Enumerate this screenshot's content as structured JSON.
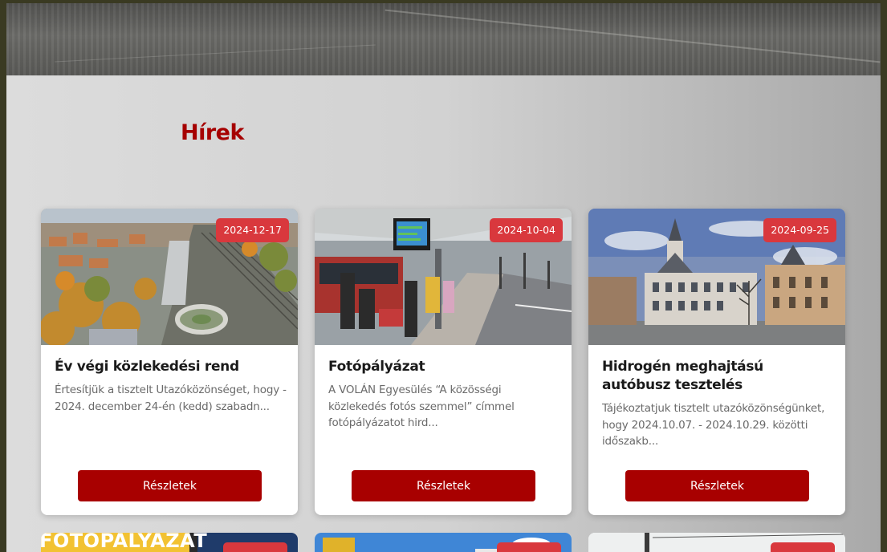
{
  "section": {
    "title": "Hírek"
  },
  "cards": [
    {
      "date": "2024-12-17",
      "title": "Év végi közlekedési rend",
      "excerpt": "Értesítjük a tisztelt Utazóközönséget, hogy - 2024. december 24-én (kedd) szabadn...",
      "button": "Részletek",
      "image": "aerial-city-roundabout-railway"
    },
    {
      "date": "2024-10-04",
      "title": "Fotópályázat",
      "excerpt": "A VOLÁN Egyesülés “A közösségi közlekedés fotós szemmel” címmel fotópályázatot hird...",
      "button": "Részletek",
      "image": "bus-station-platform"
    },
    {
      "date": "2024-09-25",
      "title": "Hidrogén meghajtású autóbusz tesztelés",
      "excerpt": "Tájékoztatjuk tisztelt utazóközönségünket, hogy 2024.10.07. - 2024.10.29. közötti időszakb...",
      "button": "Részletek",
      "image": "city-hall-square"
    }
  ],
  "peek_cards": [
    {
      "image": "fotopalyazat-poster",
      "poster_text": "FOTÓPÁLYÁZAT"
    },
    {
      "image": "blue-sky-coat-of-arms"
    },
    {
      "image": "street-pole"
    }
  ],
  "colors": {
    "accent": "#a80000",
    "badge": "#d9383d",
    "title": "#a60000"
  }
}
